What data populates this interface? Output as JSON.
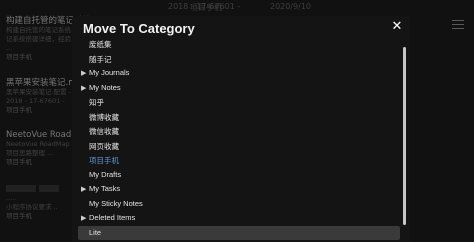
{
  "background": {
    "top_meta": [
      "2018 - 17-67601 -",
      "项目手机",
      "2020/9/10"
    ],
    "notes": [
      {
        "title": "构建自托管的笔记系统 ...",
        "excerpt": [
          "构建自托管的笔记系统...",
          "记系统搭建详细，经验..",
          "..."
        ],
        "category": "项目手机"
      },
      {
        "title": "黑苹果安装笔记.md",
        "excerpt": [
          "黑苹果安装笔记.配置 - ..",
          "2018 - 17-67601 -"
        ],
        "category": "项目手机"
      },
      {
        "title": "NeetoVue RoadMap...",
        "excerpt": [
          "NeetoVue RoadMap 项...",
          "项目思路整理 ..."
        ],
        "category": "项目手机"
      },
      {
        "title": "",
        "excerpt": [
          "..... ",
          "小程序协议要求 .."
        ],
        "category": "项目手机"
      }
    ]
  },
  "modal": {
    "title": "Move To Category",
    "close_icon": "close-icon",
    "categories": [
      {
        "label": "废纸集",
        "expandable": false,
        "state": "normal"
      },
      {
        "label": "随手记",
        "expandable": false,
        "state": "normal"
      },
      {
        "label": "My Journals",
        "expandable": true,
        "state": "normal"
      },
      {
        "label": "My Notes",
        "expandable": true,
        "state": "normal"
      },
      {
        "label": "知乎",
        "expandable": false,
        "state": "normal"
      },
      {
        "label": "微博收藏",
        "expandable": false,
        "state": "normal"
      },
      {
        "label": "微信收藏",
        "expandable": false,
        "state": "normal"
      },
      {
        "label": "网页收藏",
        "expandable": false,
        "state": "normal"
      },
      {
        "label": "项目手机",
        "expandable": false,
        "state": "active"
      },
      {
        "label": "My Drafts",
        "expandable": false,
        "state": "normal"
      },
      {
        "label": "My Tasks",
        "expandable": true,
        "state": "normal"
      },
      {
        "label": "My Sticky Notes",
        "expandable": false,
        "state": "normal"
      },
      {
        "label": "Deleted Items",
        "expandable": true,
        "state": "normal"
      },
      {
        "label": "Lite",
        "expandable": false,
        "state": "selected"
      }
    ]
  },
  "colors": {
    "active_text": "#5b9bd5",
    "selected_row": "#3a3a3a",
    "modal_bg": "#141414"
  }
}
